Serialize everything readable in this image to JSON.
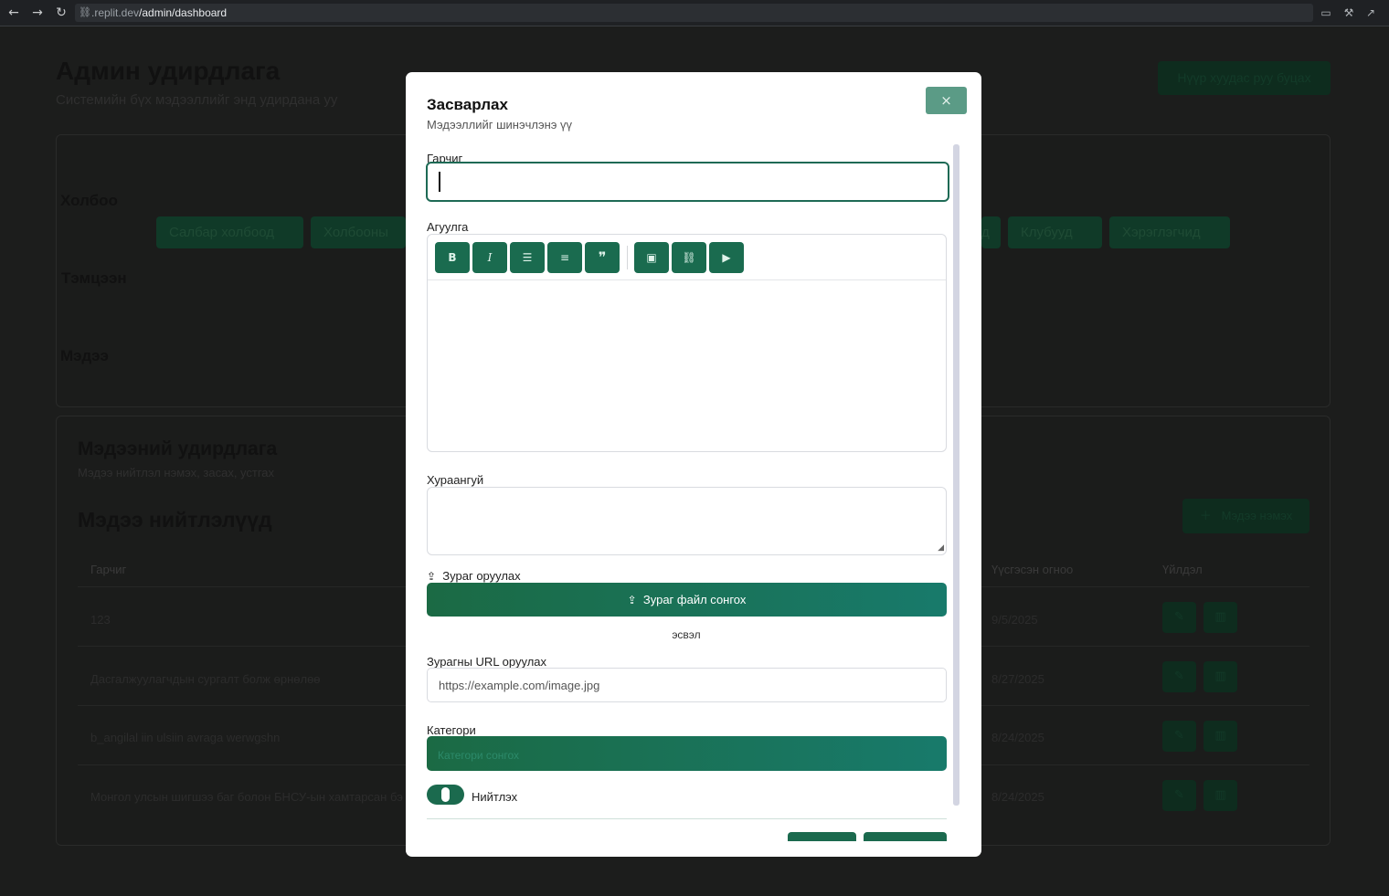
{
  "browser": {
    "url_prefix": ".replit.dev",
    "url_path": "/admin/dashboard"
  },
  "page": {
    "title": "Админ удирдлага",
    "subtitle": "Системийн бүх мэдээллийг энд удирдана уу",
    "back_button": "Нүүр хуудас руу буцах",
    "sections": {
      "holboo": "Холбоо",
      "temtseen": "Тэмцээн",
      "medee": "Мэдээ"
    },
    "nav_pills": [
      {
        "label": "Салбар холбоод"
      },
      {
        "label": "Холбооны"
      },
      {
        "label": "д"
      },
      {
        "label": "Клубууд"
      },
      {
        "label": "Хэрэглэгчид"
      }
    ],
    "news_mgmt": {
      "title": "Мэдээний удирдлага",
      "subtitle": "Мэдээ нийтлэл нэмэх, засах, устгах",
      "list_title": "Мэдээ нийтлэлүүд",
      "add_button": "Мэдээ нэмэх",
      "columns": {
        "title": "Гарчиг",
        "created": "Үүсгэсэн огноо",
        "actions": "Үйлдэл"
      },
      "rows": [
        {
          "title": "123",
          "created": "9/5/2025"
        },
        {
          "title": "Дасгалжуулагчдын сургалт болж өрнөлөө",
          "created": "8/27/2025"
        },
        {
          "title": "b_angilal iin ulsiin avraga werwgshn",
          "created": "8/24/2025"
        },
        {
          "title": "Монгол улсын шигшээ баг болон БНСУ-ын хамтарсан бэ",
          "created": "8/24/2025"
        }
      ]
    }
  },
  "modal": {
    "title": "Засварлах",
    "subtitle": "Мэдээллийг шинэчлэнэ үү",
    "close_icon": "×",
    "fields": {
      "title_label": "Гарчиг",
      "title_value": "",
      "content_label": "Агуулга",
      "summary_label": "Хураангуй",
      "image_label": "Зураг оруулах",
      "upload_button": "Зураг файл сонгох",
      "or_text": "эсвэл",
      "url_label": "Зурагны URL оруулах",
      "url_placeholder": "https://example.com/image.jpg",
      "category_label": "Категори",
      "category_placeholder": "Категори сонгох",
      "publish_label": "Нийтлэх",
      "publish_on": true
    },
    "editor_tools": [
      "bold-icon",
      "italic-icon",
      "bullet-list-icon",
      "numbered-list-icon",
      "quote-icon",
      "image-icon",
      "link-icon",
      "video-icon"
    ]
  },
  "colors": {
    "accent": "#1b6a4e",
    "gradient_start": "#1b6a44",
    "gradient_end": "#187a6b",
    "close_button": "#5b9b86"
  }
}
